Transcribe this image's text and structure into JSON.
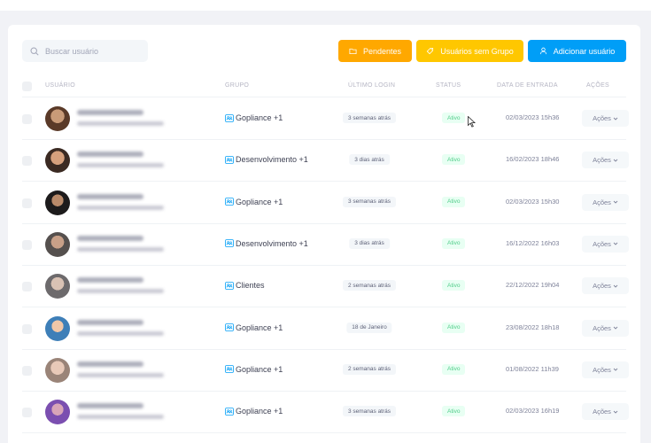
{
  "search": {
    "placeholder": "Buscar usuário",
    "value": ""
  },
  "buttons": {
    "pendentes": "Pendentes",
    "sem_grupo": "Usuários sem Grupo",
    "adicionar": "Adicionar usuário"
  },
  "colors": {
    "pendentes": "#ffa800",
    "sem_grupo": "#ffc700",
    "adicionar": "#009ef7",
    "status_active": "#50cd89"
  },
  "table": {
    "headers": {
      "usuario": "USUÁRIO",
      "grupo": "GRUPO",
      "ultimo_login": "ÚLTIMO LOGIN",
      "status": "STATUS",
      "data_entrada": "DATA DE ENTRADA",
      "acoes": "AÇÕES"
    },
    "rows": [
      {
        "group": "Gopliance +1",
        "last_login": "3 semanas atrás",
        "status": "Ativo",
        "date": "02/03/2023 15h36",
        "actions": "Ações"
      },
      {
        "group": "Desenvolvimento +1",
        "last_login": "3 dias atrás",
        "status": "Ativo",
        "date": "16/02/2023 18h46",
        "actions": "Ações"
      },
      {
        "group": "Gopliance +1",
        "last_login": "3 semanas atrás",
        "status": "Ativo",
        "date": "02/03/2023 15h30",
        "actions": "Ações"
      },
      {
        "group": "Desenvolvimento +1",
        "last_login": "3 dias atrás",
        "status": "Ativo",
        "date": "16/12/2022 16h03",
        "actions": "Ações"
      },
      {
        "group": "Clientes",
        "last_login": "2 semanas atrás",
        "status": "Ativo",
        "date": "22/12/2022 19h04",
        "actions": "Ações"
      },
      {
        "group": "Gopliance +1",
        "last_login": "18 de Janeiro",
        "status": "Ativo",
        "date": "23/08/2022 18h18",
        "actions": "Ações"
      },
      {
        "group": "Gopliance +1",
        "last_login": "2 semanas atrás",
        "status": "Ativo",
        "date": "01/08/2022 11h39",
        "actions": "Ações"
      },
      {
        "group": "Gopliance +1",
        "last_login": "3 semanas atrás",
        "status": "Ativo",
        "date": "02/03/2023 16h19",
        "actions": "Ações"
      }
    ]
  }
}
